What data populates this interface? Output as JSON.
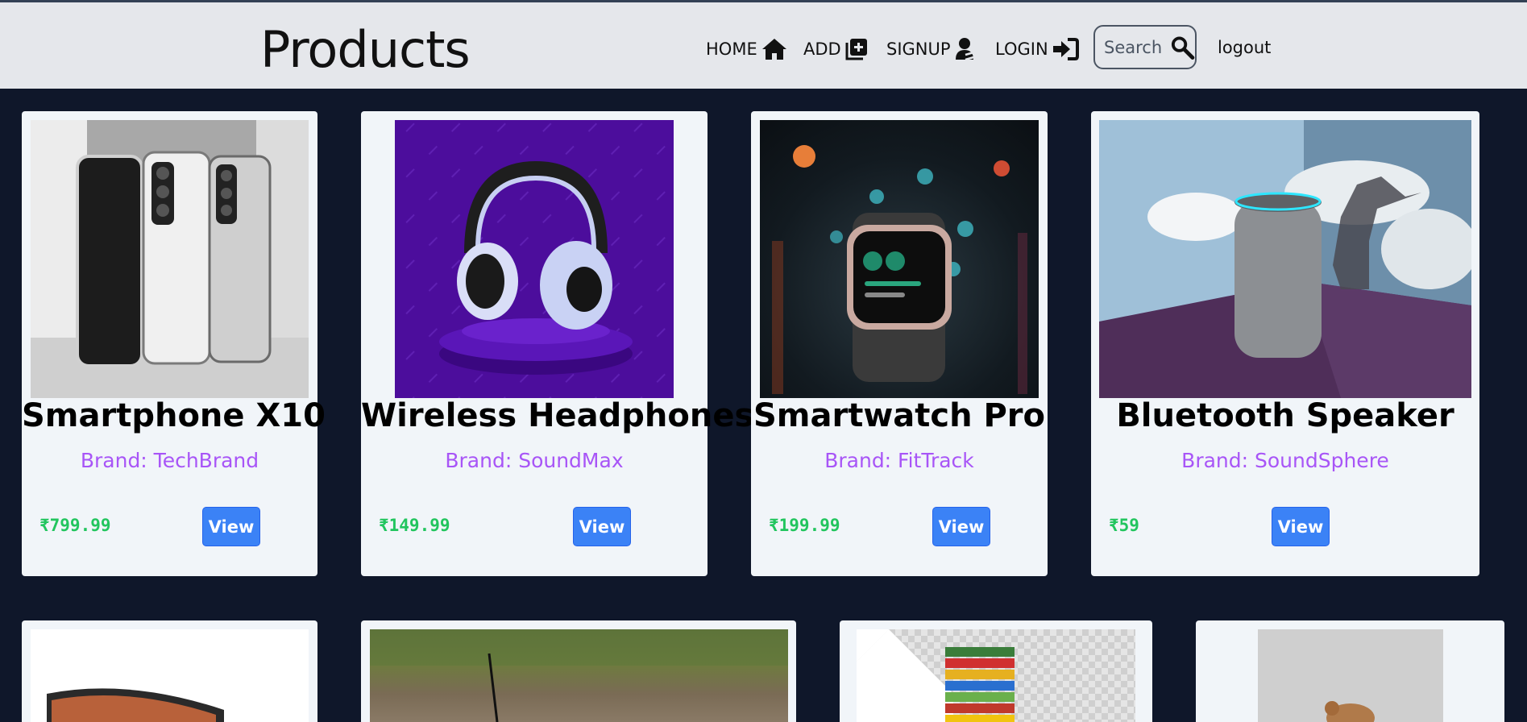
{
  "header": {
    "title": "Products",
    "nav": [
      {
        "label": "HOME",
        "icon": "home-icon"
      },
      {
        "label": "ADD",
        "icon": "add-square-icon"
      },
      {
        "label": "SIGNUP",
        "icon": "user-signup-icon"
      },
      {
        "label": "LOGIN",
        "icon": "login-arrow-icon"
      }
    ],
    "search": {
      "placeholder": "Search",
      "icon": "search-icon"
    },
    "logout_label": "logout"
  },
  "products": [
    {
      "name": "Smartphone X10",
      "brand": "Brand: TechBrand",
      "price": "₹799.99",
      "view_label": "View",
      "image": "smartphone-image"
    },
    {
      "name": "Wireless Headphones",
      "brand": "Brand: SoundMax",
      "price": "₹149.99",
      "view_label": "View",
      "image": "headphones-image"
    },
    {
      "name": "Smartwatch Pro",
      "brand": "Brand: FitTrack",
      "price": "₹199.99",
      "view_label": "View",
      "image": "smartwatch-image"
    },
    {
      "name": "Bluetooth Speaker",
      "brand": "Brand: SoundSphere",
      "price": "₹59",
      "view_label": "View",
      "image": "speaker-image"
    }
  ],
  "partial_products": [
    {
      "image": "curved-monitor-image"
    },
    {
      "image": "drone-grass-image"
    },
    {
      "image": "jenga-blocks-image"
    },
    {
      "image": "teddy-bear-image"
    }
  ],
  "colors": {
    "background": "#0f172a",
    "header": "#e5e7eb",
    "card": "#f1f5f9",
    "brand_text": "#a855f7",
    "price_text": "#22c55e",
    "button": "#3b82f6"
  }
}
